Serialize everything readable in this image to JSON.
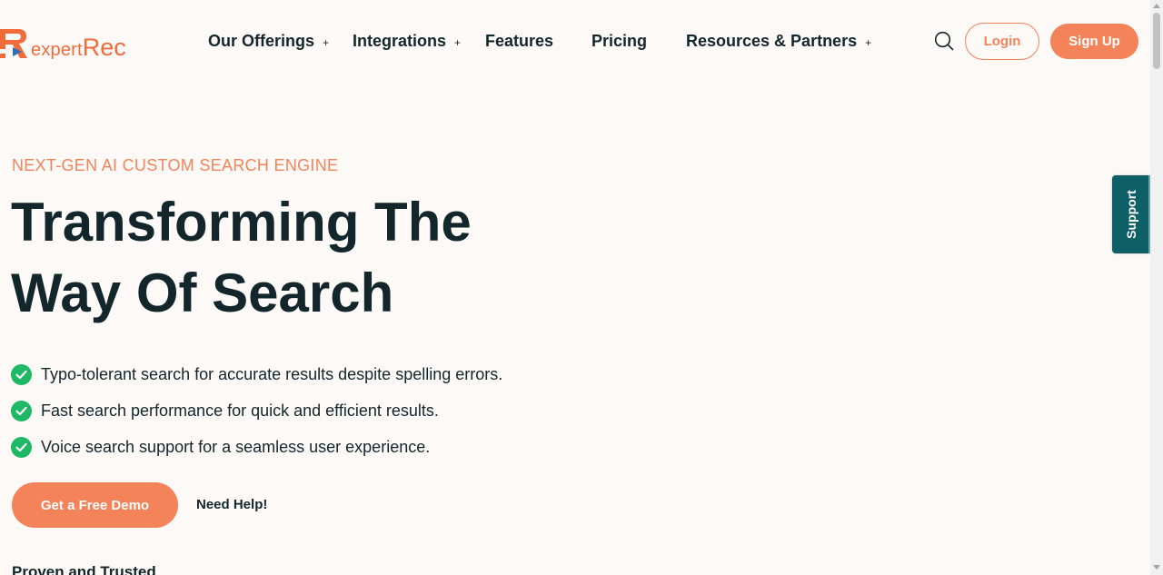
{
  "brand": {
    "logo_small_text": "expert",
    "logo_large_text": "Rec",
    "accent_color": "#f4835a",
    "dark_color": "#13262b",
    "teal_color": "#0f5f66",
    "check_color": "#1fb866"
  },
  "nav": {
    "items": [
      {
        "label": "Our Offerings",
        "has_submenu": true
      },
      {
        "label": "Integrations",
        "has_submenu": true
      },
      {
        "label": "Features",
        "has_submenu": false
      },
      {
        "label": "Pricing",
        "has_submenu": false
      },
      {
        "label": "Resources & Partners",
        "has_submenu": true
      }
    ],
    "submenu_marker": "+",
    "search_icon": "search-icon",
    "login_label": "Login",
    "signup_label": "Sign Up"
  },
  "hero": {
    "eyebrow": "NEXT-GEN AI CUSTOM SEARCH ENGINE",
    "headline_line1": "Transforming The",
    "headline_line2": "Way Of Search",
    "features": [
      "Typo-tolerant search for accurate results despite spelling errors.",
      "Fast search performance for quick and efficient results.",
      "Voice search support for a seamless user experience."
    ],
    "feature_icon": "check-circle-icon",
    "demo_button_label": "Get a Free Demo",
    "need_help_label": "Need Help!",
    "proven_heading": "Proven and Trusted"
  },
  "support_tab": {
    "label": "Support"
  }
}
